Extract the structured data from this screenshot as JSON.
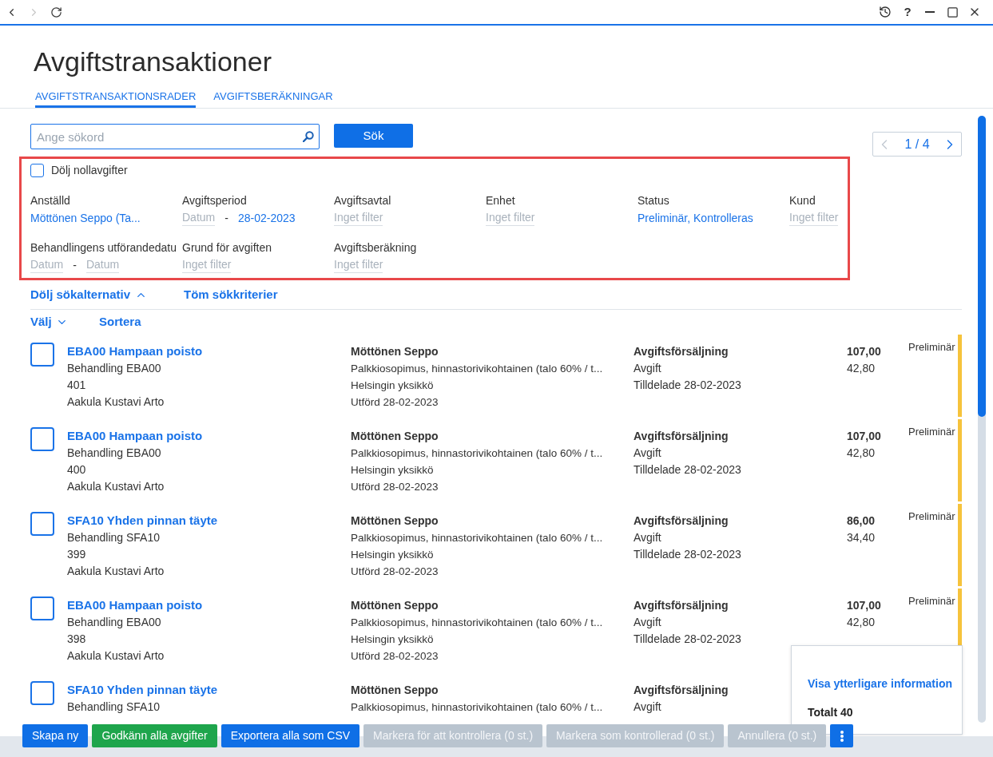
{
  "nav_buttons": [
    {
      "kind": "back",
      "disabled": false
    },
    {
      "kind": "forward",
      "disabled": true
    },
    {
      "kind": "refresh",
      "disabled": false
    }
  ],
  "window_buttons": [
    {
      "kind": "history"
    },
    {
      "kind": "help",
      "label": "?"
    },
    {
      "kind": "minimize"
    },
    {
      "kind": "maximize"
    },
    {
      "kind": "close"
    }
  ],
  "page": {
    "title": "Avgiftstransaktioner"
  },
  "tabs": [
    {
      "label": "AVGIFTSTRANSAKTIONSRADER",
      "selected": true
    },
    {
      "label": "AVGIFTSBERÄKNINGAR",
      "selected": false
    }
  ],
  "search": {
    "placeholder": "Ange sökord",
    "button": "Sök"
  },
  "pagination": {
    "label": "1 / 4",
    "prev_disabled": true,
    "next_disabled": false
  },
  "filters": {
    "highlighted": true,
    "hide_zero": {
      "label": "Dölj nollavgifter",
      "checked": false
    },
    "fields": [
      {
        "kind": "select",
        "label": "Anställd",
        "value": "Möttönen Seppo (Ta..."
      },
      {
        "kind": "date_range",
        "label": "Avgiftsperiod",
        "from": {
          "placeholder": "Datum"
        },
        "separator": "-",
        "to": {
          "value": "28-02-2023"
        }
      },
      {
        "kind": "select",
        "label": "Avgiftsavtal",
        "placeholder": "Inget filter"
      },
      {
        "kind": "select",
        "label": "Enhet",
        "placeholder": "Inget filter"
      },
      {
        "kind": "select",
        "label": "Status",
        "value": "Preliminär, Kontrolleras"
      },
      {
        "kind": "select",
        "label": "Kund",
        "placeholder": "Inget filter"
      },
      {
        "kind": "date_range",
        "label": "Behandlingens utförandedatu",
        "from": {
          "placeholder": "Datum"
        },
        "separator": "-",
        "to": {
          "placeholder": "Datum"
        }
      },
      {
        "kind": "select",
        "label": "Grund för avgiften",
        "placeholder": "Inget filter"
      },
      {
        "kind": "select",
        "label": "Avgiftsberäkning",
        "placeholder": "Inget filter"
      }
    ]
  },
  "filter_actions": [
    {
      "kind": "toggle",
      "label": "Dölj sökalternativ",
      "expanded": true
    },
    {
      "kind": "link",
      "label": "Töm sökkriterier"
    }
  ],
  "list_actions": [
    {
      "kind": "menu",
      "label": "Välj"
    },
    {
      "kind": "link",
      "label": "Sortera"
    }
  ],
  "rows": [
    {
      "selected": false,
      "title": "EBA00 Hampaan poisto",
      "details": [
        "Behandling EBA00",
        "401",
        "Aakula Kustavi Arto"
      ],
      "employee": {
        "name": "Möttönen Seppo",
        "details": [
          "Palkkiosopimus, hinnastorivikohtainen (talo 60% / t...",
          "Helsingin yksikkö",
          "Utförd 28-02-2023"
        ]
      },
      "fee": {
        "type": "Avgiftsförsäljning",
        "details": [
          "Avgift",
          "Tilldelade 28-02-2023"
        ]
      },
      "amounts": [
        "107,00",
        "42,80"
      ],
      "status": {
        "label": "Preliminär",
        "color": "#f6c33c"
      }
    },
    {
      "selected": false,
      "title": "EBA00 Hampaan poisto",
      "details": [
        "Behandling EBA00",
        "400",
        "Aakula Kustavi Arto"
      ],
      "employee": {
        "name": "Möttönen Seppo",
        "details": [
          "Palkkiosopimus, hinnastorivikohtainen (talo 60% / t...",
          "Helsingin yksikkö",
          "Utförd 28-02-2023"
        ]
      },
      "fee": {
        "type": "Avgiftsförsäljning",
        "details": [
          "Avgift",
          "Tilldelade 28-02-2023"
        ]
      },
      "amounts": [
        "107,00",
        "42,80"
      ],
      "status": {
        "label": "Preliminär",
        "color": "#f6c33c"
      }
    },
    {
      "selected": false,
      "title": "SFA10 Yhden pinnan täyte",
      "details": [
        "Behandling SFA10",
        "399",
        "Aakula Kustavi Arto"
      ],
      "employee": {
        "name": "Möttönen Seppo",
        "details": [
          "Palkkiosopimus, hinnastorivikohtainen (talo 60% / t...",
          "Helsingin yksikkö",
          "Utförd 28-02-2023"
        ]
      },
      "fee": {
        "type": "Avgiftsförsäljning",
        "details": [
          "Avgift",
          "Tilldelade 28-02-2023"
        ]
      },
      "amounts": [
        "86,00",
        "34,40"
      ],
      "status": {
        "label": "Preliminär",
        "color": "#f6c33c"
      }
    },
    {
      "selected": false,
      "title": "EBA00 Hampaan poisto",
      "details": [
        "Behandling EBA00",
        "398",
        "Aakula Kustavi Arto"
      ],
      "employee": {
        "name": "Möttönen Seppo",
        "details": [
          "Palkkiosopimus, hinnastorivikohtainen (talo 60% / t...",
          "Helsingin yksikkö",
          "Utförd 28-02-2023"
        ]
      },
      "fee": {
        "type": "Avgiftsförsäljning",
        "details": [
          "Avgift",
          "Tilldelade 28-02-2023"
        ]
      },
      "amounts": [
        "107,00",
        "42,80"
      ],
      "status": {
        "label": "Preliminär",
        "color": "#f6c33c"
      }
    },
    {
      "selected": false,
      "title": "SFA10 Yhden pinnan täyte",
      "details": [
        "Behandling SFA10"
      ],
      "employee": {
        "name": "Möttönen Seppo",
        "details": [
          "Palkkiosopimus, hinnastorivikohtainen (talo 60% / t..."
        ]
      },
      "fee": {
        "type": "Avgiftsförsäljning",
        "details": [
          "Avgift"
        ]
      }
    }
  ],
  "summary": {
    "link": "Visa ytterligare information",
    "total": "Totalt 40"
  },
  "footer_buttons": [
    {
      "kind": "primary",
      "label": "Skapa ny",
      "disabled": false
    },
    {
      "kind": "success",
      "label": "Godkänn alla avgifter",
      "disabled": false
    },
    {
      "kind": "primary",
      "label": "Exportera alla som CSV",
      "disabled": false
    },
    {
      "kind": "primary",
      "label": "Markera för att kontrollera (0 st.)",
      "disabled": true
    },
    {
      "kind": "primary",
      "label": "Markera som kontrollerad (0 st.)",
      "disabled": true
    },
    {
      "kind": "primary",
      "label": "Annullera (0 st.)",
      "disabled": true
    },
    {
      "kind": "more",
      "disabled": false
    }
  ]
}
